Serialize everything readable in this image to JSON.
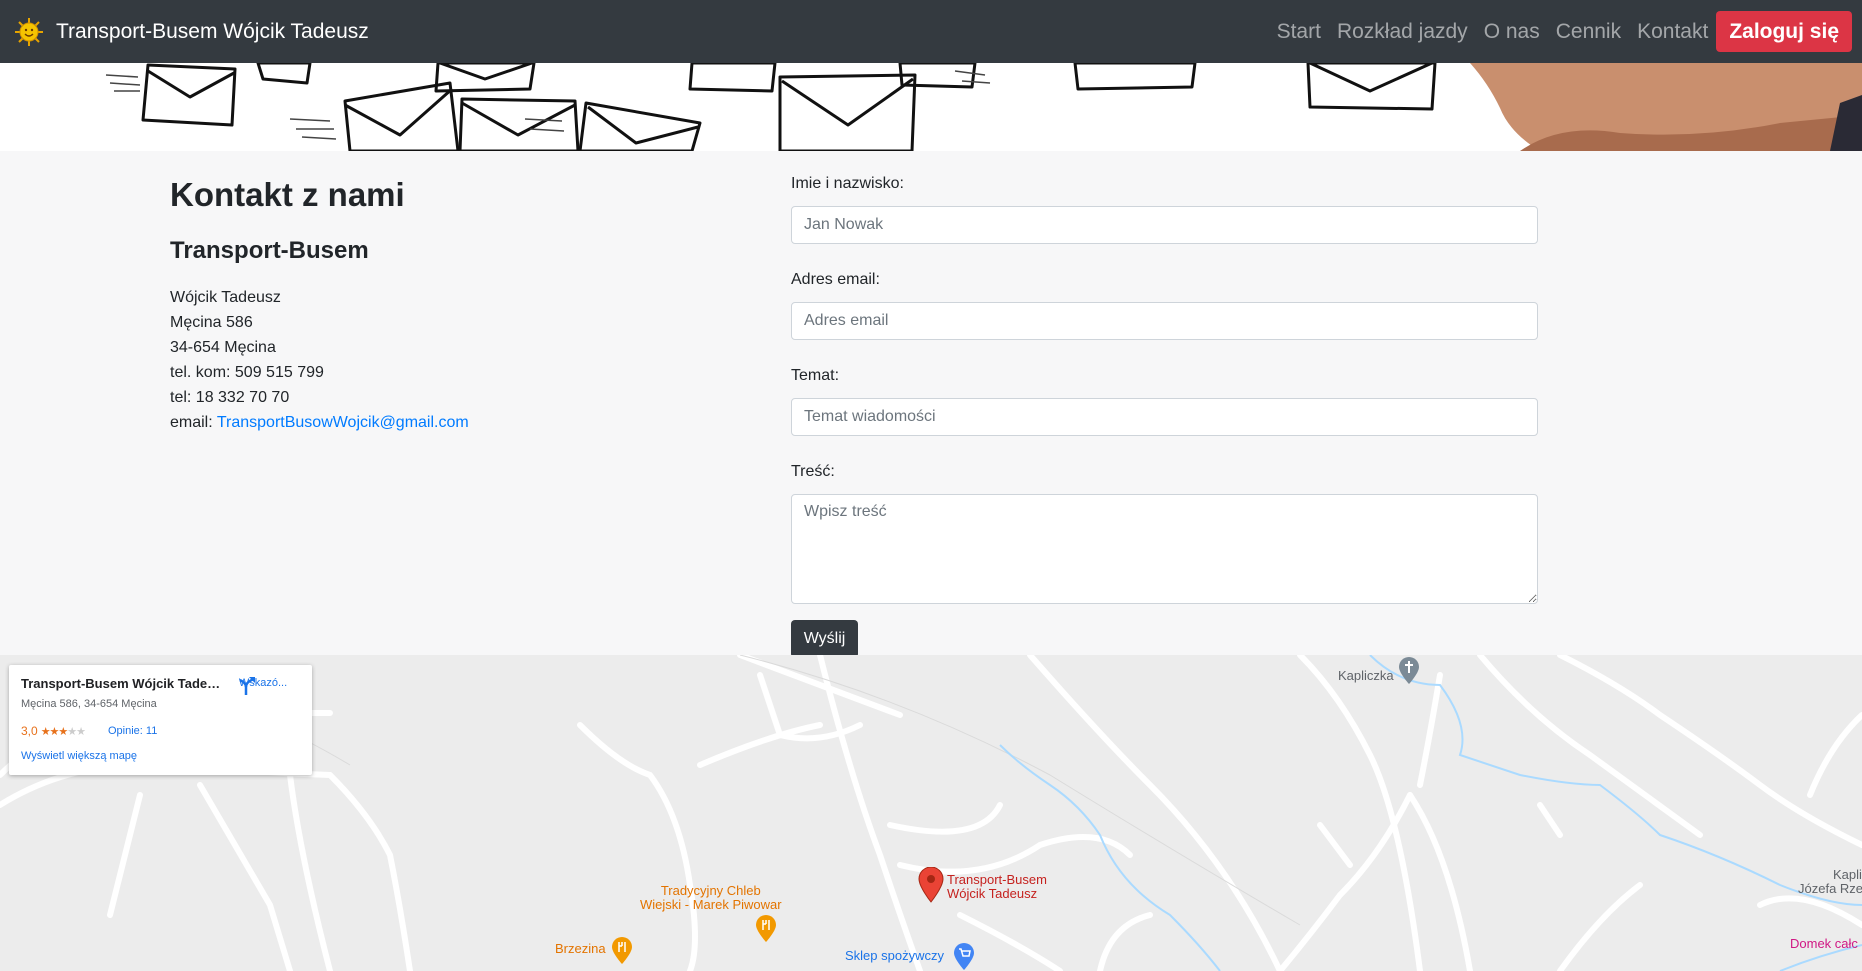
{
  "navbar": {
    "brand": "Transport-Busem Wójcik Tadeusz",
    "links": [
      "Start",
      "Rozkład jazdy",
      "O nas",
      "Cennik",
      "Kontakt"
    ],
    "login": "Zaloguj się"
  },
  "contact": {
    "title": "Kontakt z nami",
    "company": "Transport-Busem",
    "lines": [
      "Wójcik Tadeusz",
      "Męcina 586",
      "34-654 Męcina",
      "tel. kom: 509 515 799",
      "tel: 18 332 70 70"
    ],
    "email_label": "email: ",
    "email": "TransportBusowWojcik@gmail.com"
  },
  "form": {
    "name_label": "Imie i nazwisko:",
    "name_placeholder": "Jan Nowak",
    "email_label": "Adres email:",
    "email_placeholder": "Adres email",
    "subject_label": "Temat:",
    "subject_placeholder": "Temat wiadomości",
    "body_label": "Treść:",
    "body_placeholder": "Wpisz treść",
    "submit": "Wyślij"
  },
  "map": {
    "card": {
      "title": "Transport-Busem Wójcik Tadeusz",
      "address": "Męcina 586, 34-654 Męcina",
      "rating": "3,0",
      "stars_filled": 3,
      "reviews": "Opinie: 11",
      "directions": "Wskazó...",
      "larger_map": "Wyświetl większą mapę"
    },
    "places": {
      "business_line1": "Transport-Busem",
      "business_line2": "Wójcik Tadeusz",
      "bakery_line1": "Tradycyjny Chleb",
      "bakery_line2": "Wiejski - Marek Piwowar",
      "brzezina": "Brzezina",
      "shop": "Sklep spożywczy",
      "kapliczka": "Kapliczka",
      "kapli_right_line1": "Kapli",
      "kapli_right_line2": "Józefa Rze",
      "domek": "Domek całc"
    },
    "colors": {
      "business": "#c5221f",
      "food": "#e37400",
      "shop": "#1a73e8",
      "religious": "#70757a",
      "lodging": "#d01884"
    }
  }
}
